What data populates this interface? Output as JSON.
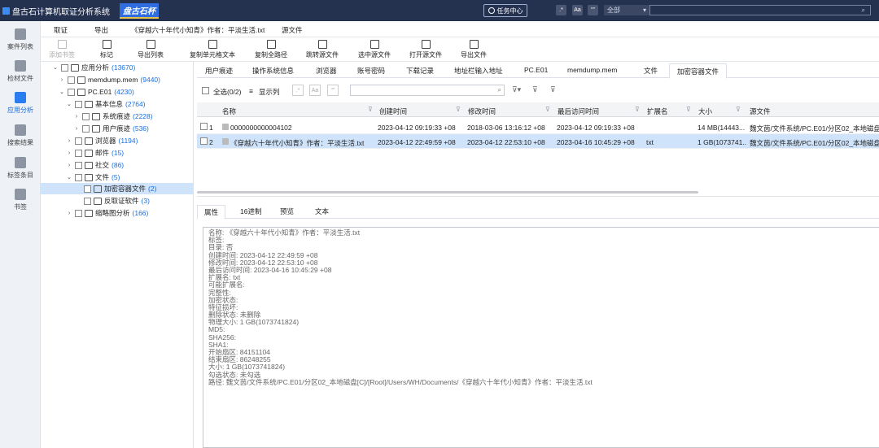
{
  "titlebar": {
    "app_title": "盘古石计算机取证分析系统",
    "brand": "盘古石杯",
    "task_center": "任务中心",
    "btn_regex": ".*",
    "btn_case": "Aa",
    "btn_quote": "“”",
    "scope": "全部"
  },
  "leftbar": {
    "items": [
      "案件列表",
      "检材文件",
      "应用分析",
      "搜索结果",
      "标签条目",
      "书签"
    ]
  },
  "menubar": {
    "items": [
      "取证",
      "导出",
      "《穿越六十年代小知青》作者：平淡生活.txt",
      "源文件"
    ]
  },
  "toolbar": {
    "items": [
      "添加书签",
      "标记",
      "导出列表",
      "复制单元格文本",
      "复制全路径",
      "跳转源文件",
      "选中源文件",
      "打开源文件",
      "导出文件"
    ]
  },
  "tree": {
    "root": {
      "label": "应用分析",
      "count": "(13670)"
    },
    "memdump": {
      "label": "memdump.mem",
      "count": "(9440)"
    },
    "pc": {
      "label": "PC.E01",
      "count": "(4230)"
    },
    "basic": {
      "label": "基本信息",
      "count": "(2764)"
    },
    "sys": {
      "label": "系统痕迹",
      "count": "(2228)"
    },
    "user": {
      "label": "用户痕迹",
      "count": "(536)"
    },
    "browser": {
      "label": "浏览器",
      "count": "(1194)"
    },
    "mail": {
      "label": "邮件",
      "count": "(15)"
    },
    "social": {
      "label": "社交",
      "count": "(86)"
    },
    "files": {
      "label": "文件",
      "count": "(5)"
    },
    "enc": {
      "label": "加密容器文件",
      "count": "(2)"
    },
    "anti": {
      "label": "反取证软件",
      "count": "(3)"
    },
    "thumb": {
      "label": "缩略图分析",
      "count": "(166)"
    }
  },
  "subtabs": [
    "用户痕迹",
    "操作系统信息",
    "浏览器",
    "账号密码",
    "下载记录",
    "地址栏输入地址",
    "PC.E01",
    "memdump.mem",
    "文件",
    "加密容器文件"
  ],
  "listbar": {
    "select_all": "全选(0/2)",
    "show_cols": "显示列",
    "btn_regex": ".*",
    "btn_case": "Aa",
    "btn_quote": "“”"
  },
  "table": {
    "headers": [
      "名称",
      "创建时间",
      "修改时间",
      "最后访问时间",
      "扩展名",
      "大小",
      "源文件"
    ],
    "rows": [
      {
        "idx": "1",
        "name": "0000000000004102",
        "created": "2023-04-12 09:19:33 +08",
        "modified": "2018-03-06 13:16:12 +08",
        "accessed": "2023-04-12 09:19:33 +08",
        "ext": "",
        "size": "14 MB(14443...",
        "src": "魏文茵/文件系统/PC.E01/分区02_本地磁盘[C"
      },
      {
        "idx": "2",
        "name": "《穿越六十年代小知青》作者：平淡生活.txt",
        "created": "2023-04-12 22:49:59 +08",
        "modified": "2023-04-12 22:53:10 +08",
        "accessed": "2023-04-16 10:45:29 +08",
        "ext": "txt",
        "size": "1 GB(1073741...",
        "src": "魏文茵/文件系统/PC.E01/分区02_本地磁盘[C"
      }
    ]
  },
  "ptabs": [
    "属性",
    "16进制",
    "预览",
    "文本"
  ],
  "props": [
    "名称: 《穿越六十年代小知青》作者：平淡生活.txt",
    "标签:",
    "目录: 否",
    "创建时间: 2023-04-12 22:49:59 +08",
    "修改时间: 2023-04-12 22:53:10 +08",
    "最后访问时间: 2023-04-16 10:45:29 +08",
    "扩展名: txt",
    "可能扩展名:",
    "完整性:",
    "加密状态:",
    "特征损坏:",
    "删除状态: 未删除",
    "物理大小: 1 GB(1073741824)",
    "MD5:",
    "SHA256:",
    "SHA1:",
    "开始扇区: 84151104",
    "结束扇区: 86248255",
    "大小: 1 GB(1073741824)",
    "勾选状态: 未勾选",
    "路径: 魏文茵/文件系统/PC.E01/分区02_本地磁盘[C]/[Root]/Users/WH/Documents/《穿越六十年代小知青》作者：平淡生活.txt"
  ]
}
